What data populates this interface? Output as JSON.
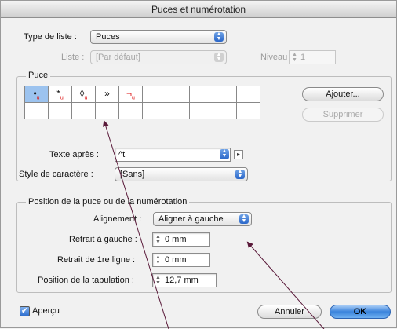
{
  "title": "Puces et numérotation",
  "type_liste": {
    "label": "Type de liste :",
    "value": "Puces"
  },
  "liste": {
    "label": "Liste :",
    "value": "[Par défaut]"
  },
  "niveau": {
    "label": "Niveau :",
    "value": "1"
  },
  "puce_group": {
    "title": "Puce",
    "bullets": [
      {
        "glyph": "•",
        "sub": "u",
        "selected": true
      },
      {
        "glyph": "*",
        "sub": "u",
        "selected": false
      },
      {
        "glyph": "◊",
        "sub": "u",
        "selected": false
      },
      {
        "glyph": "»",
        "sub": "",
        "selected": false
      },
      {
        "glyph": "¬",
        "sub": "u",
        "selected": false
      }
    ],
    "add_button": "Ajouter...",
    "delete_button": "Supprimer"
  },
  "texte_apres": {
    "label": "Texte après :",
    "value": "^t"
  },
  "style_caractere": {
    "label": "Style de caractère :",
    "value": "[Sans]"
  },
  "position_group": {
    "title": "Position de la puce ou de la numérotation",
    "alignement": {
      "label": "Alignement :",
      "value": "Aligner à gauche"
    },
    "retrait_gauche": {
      "label": "Retrait à gauche :",
      "value": "0 mm"
    },
    "retrait_1re_ligne": {
      "label": "Retrait de 1re ligne :",
      "value": "0 mm"
    },
    "position_tabulation": {
      "label": "Position de la tabulation :",
      "value": "12,7 mm"
    }
  },
  "apercu": {
    "label": "Aperçu",
    "checked": true
  },
  "buttons": {
    "cancel": "Annuler",
    "ok": "OK"
  }
}
